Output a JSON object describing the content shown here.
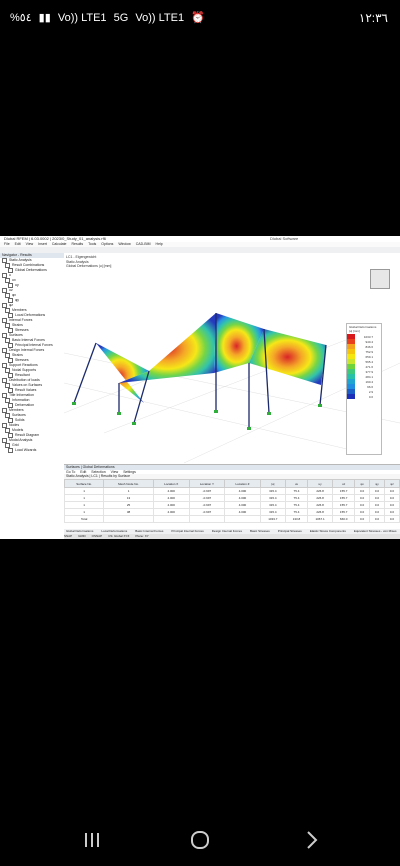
{
  "status_bar": {
    "left_items": [
      "%٥٤",
      "Vo))\nLTE1",
      "5G",
      "Vo))\nLTE1"
    ],
    "time": "١٢:٣٦"
  },
  "app": {
    "window_title": "Dlubal RFEM | 6.03.0002 | 2023/0_Study_01_analysis.rf6",
    "window_right": "Dlubal Software",
    "menu": [
      "File",
      "Edit",
      "View",
      "Insert",
      "Calculate",
      "Results",
      "Tools",
      "Options",
      "Window",
      "CAD-BIM",
      "Help"
    ],
    "navigator": {
      "header": "Navigator - Results",
      "items": [
        "Static Analysis",
        "Result Combinations",
        "Global Deformations",
        "u",
        "ux",
        "uy",
        "uz",
        "φx",
        "φy",
        "φz",
        "Members",
        "Local Deformations",
        "Internal Forces",
        "Strains",
        "Stresses",
        "Surfaces",
        "Basic Internal Forces",
        "Principal Internal Forces",
        "Design Internal Forces",
        "Strains",
        "Stresses",
        "Support Reactions",
        "Nodal Supports",
        "Resultant",
        "Distribution of loads",
        "Values on Surfaces",
        "Result Values",
        "Title Information",
        "Information",
        "Deformation",
        "Members",
        "Surfaces",
        "Solids",
        "Nodes",
        "Models",
        "Result Diagram",
        "Modal Analysis",
        "Grid",
        "Load Wizards"
      ]
    },
    "viewport": {
      "info_lines": [
        "LC1 - Eigengewicht",
        "Static Analysis",
        "Global Deformations |u| [mm]",
        "LC1 - Eigengewicht"
      ],
      "bottom_text": "max |u| : 1033.7 | min |u| : 0.0 mm"
    },
    "legend": {
      "title": "Global Deformations |u| [mm]",
      "values": [
        "1033.7",
        "940.4",
        "846.6",
        "752.9",
        "659.1",
        "565.4",
        "471.6",
        "377.9",
        "284.1",
        "190.4",
        "96.6",
        "2.9",
        "0.0"
      ]
    },
    "results_panel": {
      "title": "Surfaces | Global Deformations",
      "menu": [
        "Go To",
        "Edit",
        "Selection",
        "View",
        "Settings"
      ],
      "toolbar": "Static Analysis   |   LC1   |   Results by Surface",
      "columns": [
        "Surface No.",
        "Mesh Node No.",
        "Location X",
        "Location Y",
        "Location Z",
        "|u|",
        "ux",
        "uy",
        "uz",
        "φx",
        "φy",
        "φz"
      ],
      "rows": [
        [
          "1",
          "1",
          "4.000",
          "-0.997",
          "4.000",
          "315.4",
          "75.4",
          "226.8",
          "155.7",
          "0.0",
          "0.0",
          "0.0"
        ],
        [
          "1",
          "13",
          "4.000",
          "-0.997",
          "4.000",
          "315.4",
          "75.4",
          "226.8",
          "155.7",
          "0.0",
          "0.0",
          "0.0"
        ],
        [
          "1",
          "25",
          "4.000",
          "-0.997",
          "4.000",
          "315.4",
          "75.4",
          "226.8",
          "155.7",
          "0.0",
          "0.0",
          "0.0"
        ],
        [
          "1",
          "38",
          "4.000",
          "-0.997",
          "4.000",
          "315.4",
          "75.4",
          "226.8",
          "155.7",
          "0.0",
          "0.0",
          "0.0"
        ],
        [
          "Total",
          "",
          "",
          "",
          "",
          "1033.7",
          "133.8",
          "1067.1",
          "660.0",
          "0.0",
          "0.0",
          "0.0"
        ]
      ],
      "tabs": [
        "Global Deformations",
        "Local Deformations",
        "Basic Internal Forces",
        "Principal Internal Forces",
        "Design Internal Forces",
        "Basic Stresses",
        "Principal Stresses",
        "Elastic Stress Components",
        "Equivalent Stresses - von Mises"
      ],
      "status": [
        "SNAP",
        "GRID",
        "OSNAP",
        "CS: Global XYZ",
        "Plane: XY"
      ]
    }
  },
  "colors": {
    "contour": [
      "#d7191c",
      "#f4a21c",
      "#f5e60b",
      "#6fd33c",
      "#27c0a8",
      "#1f8de0",
      "#1b2fb8"
    ]
  }
}
